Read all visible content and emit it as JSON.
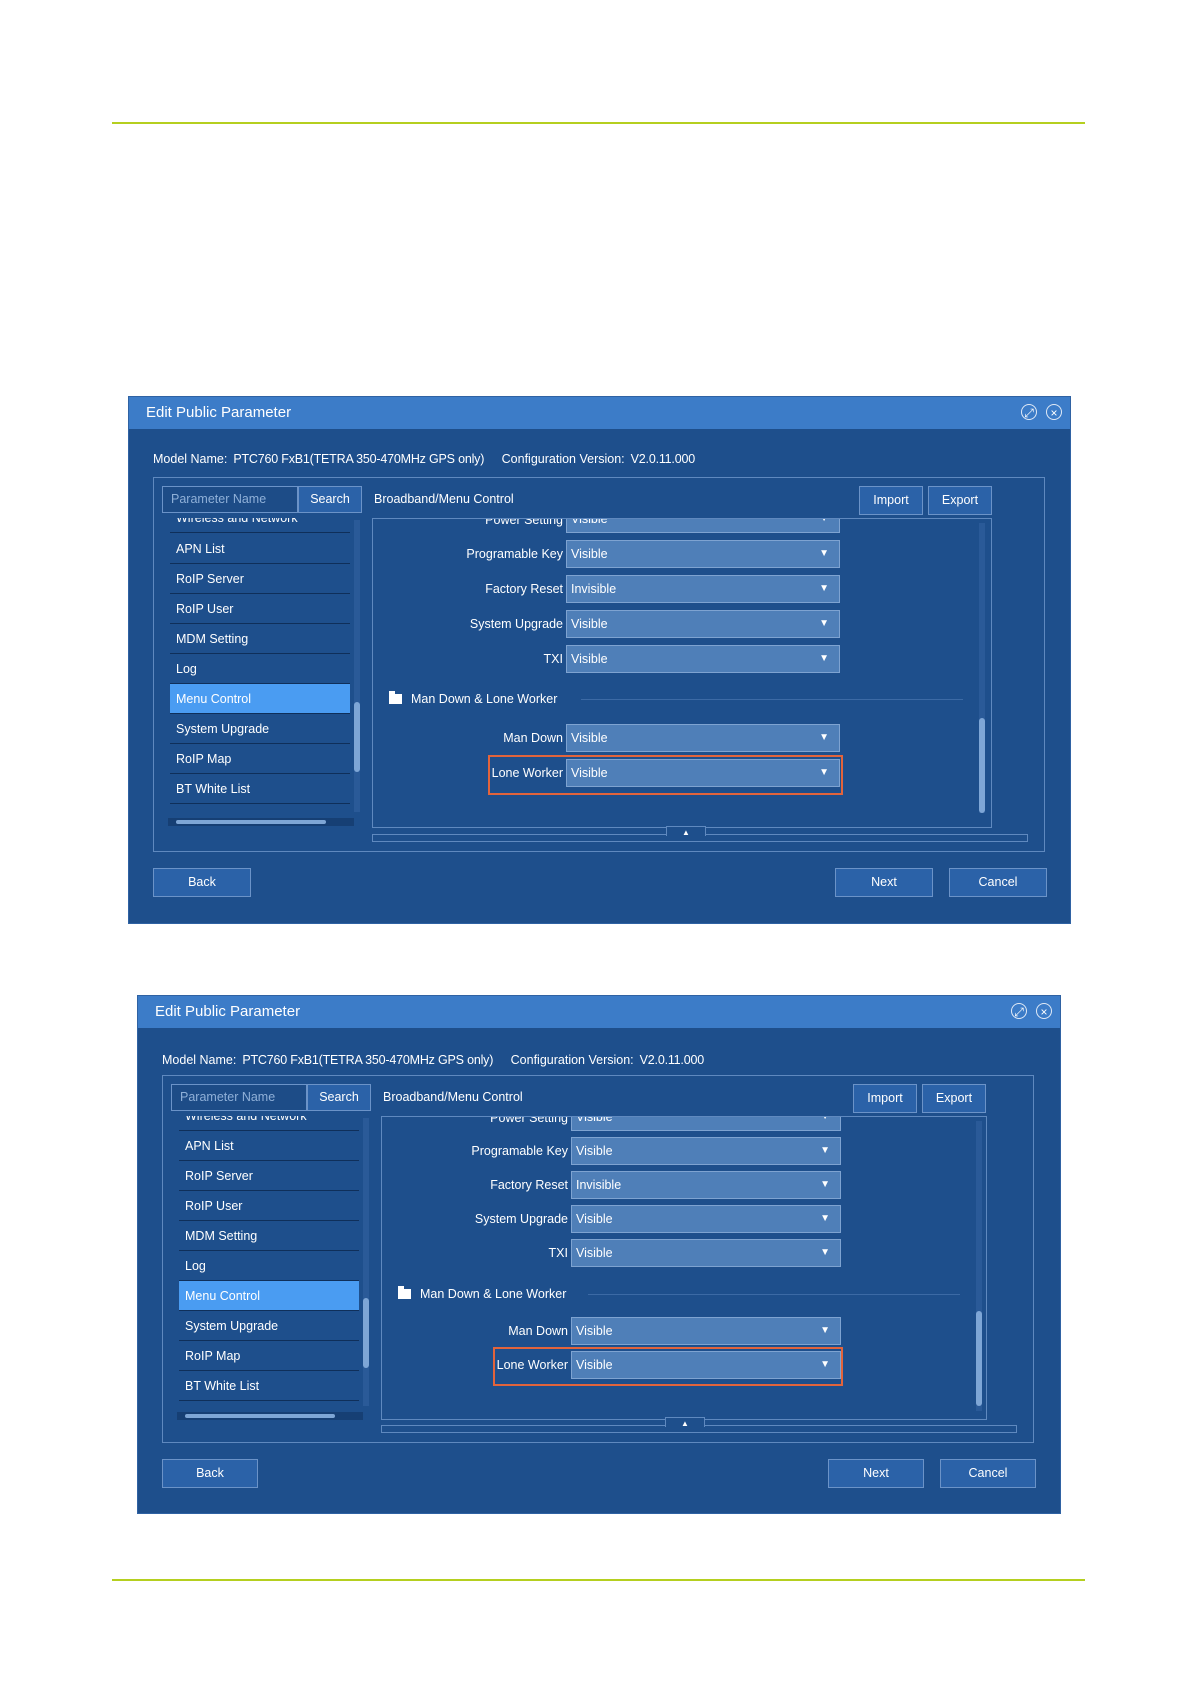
{
  "dialogs": [
    {
      "title": "Edit Public Parameter",
      "model_label": "Model Name:",
      "model_value": "PTC760 FxB1(TETRA 350-470MHz GPS only)",
      "config_label": "Configuration Version:",
      "config_value": "V2.0.11.000",
      "search_placeholder": "Parameter Name",
      "search_button": "Search",
      "breadcrumb": "Broadband/Menu Control",
      "import_button": "Import",
      "export_button": "Export",
      "tree": [
        "Wireless and Network",
        "APN List",
        "RoIP Server",
        "RoIP User",
        "MDM Setting",
        "Log",
        "Menu Control",
        "System Upgrade",
        "RoIP Map",
        "BT White List"
      ],
      "rows": [
        {
          "label": "Power Setting",
          "value": "Visible"
        },
        {
          "label": "Programable Key",
          "value": "Visible"
        },
        {
          "label": "Factory Reset",
          "value": "Invisible"
        },
        {
          "label": "System Upgrade",
          "value": "Visible"
        },
        {
          "label": "TXI",
          "value": "Visible"
        }
      ],
      "section": "Man Down & Lone Worker",
      "section_rows": [
        {
          "label": "Man Down",
          "value": "Visible"
        },
        {
          "label": "Lone Worker",
          "value": "Visible"
        }
      ],
      "back_button": "Back",
      "next_button": "Next",
      "cancel_button": "Cancel"
    },
    {
      "title": "Edit Public Parameter",
      "model_label": "Model Name:",
      "model_value": "PTC760 FxB1(TETRA 350-470MHz GPS only)",
      "config_label": "Configuration Version:",
      "config_value": "V2.0.11.000",
      "search_placeholder": "Parameter Name",
      "search_button": "Search",
      "breadcrumb": "Broadband/Menu Control",
      "import_button": "Import",
      "export_button": "Export",
      "tree": [
        "Wireless and Network",
        "APN List",
        "RoIP Server",
        "RoIP User",
        "MDM Setting",
        "Log",
        "Menu Control",
        "System Upgrade",
        "RoIP Map",
        "BT White List"
      ],
      "rows": [
        {
          "label": "Power Setting",
          "value": "Visible"
        },
        {
          "label": "Programable Key",
          "value": "Visible"
        },
        {
          "label": "Factory Reset",
          "value": "Invisible"
        },
        {
          "label": "System Upgrade",
          "value": "Visible"
        },
        {
          "label": "TXI",
          "value": "Visible"
        }
      ],
      "section": "Man Down & Lone Worker",
      "section_rows": [
        {
          "label": "Man Down",
          "value": "Visible"
        },
        {
          "label": "Lone Worker",
          "value": "Visible"
        }
      ],
      "back_button": "Back",
      "next_button": "Next",
      "cancel_button": "Cancel"
    }
  ],
  "colors": {
    "rule": "#b5cf1f",
    "dialog_bg": "#1e4f8c",
    "titlebar": "#3c7cc8",
    "selected": "#4a9cf2",
    "highlight": "#e2643c"
  },
  "selected_tree_item": "Menu Control",
  "highlighted_row": "Lone Worker"
}
